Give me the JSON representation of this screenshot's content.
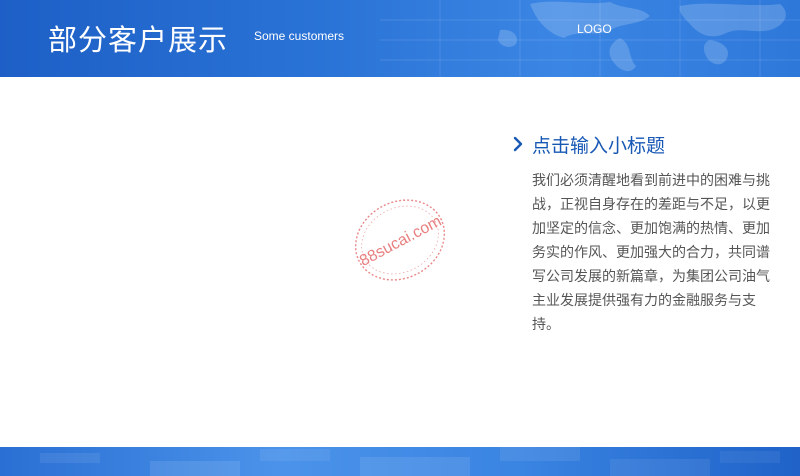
{
  "header": {
    "title": "部分客户展示",
    "subtitle": "Some customers",
    "logo": "LOGO"
  },
  "content": {
    "sub_title": "点击输入小标题",
    "paragraph": "我们必须清醒地看到前进中的困难与挑战，正视自身存在的差距与不足，以更加坚定的信念、更加饱满的热情、更加务实的作风、更加强大的合力，共同谱写公司发展的新篇章，为集团公司油气主业发展提供强有力的金融服务与支持。"
  },
  "watermark": {
    "text": "88sucai.com"
  },
  "colors": {
    "header_blue": "#1d5fc6",
    "subtitle_blue": "#1758b5",
    "body_text": "#555555",
    "stamp_red": "#e46a6a"
  },
  "icons": {
    "bullet": "chevron-right-icon",
    "map": "world-map-icon"
  }
}
